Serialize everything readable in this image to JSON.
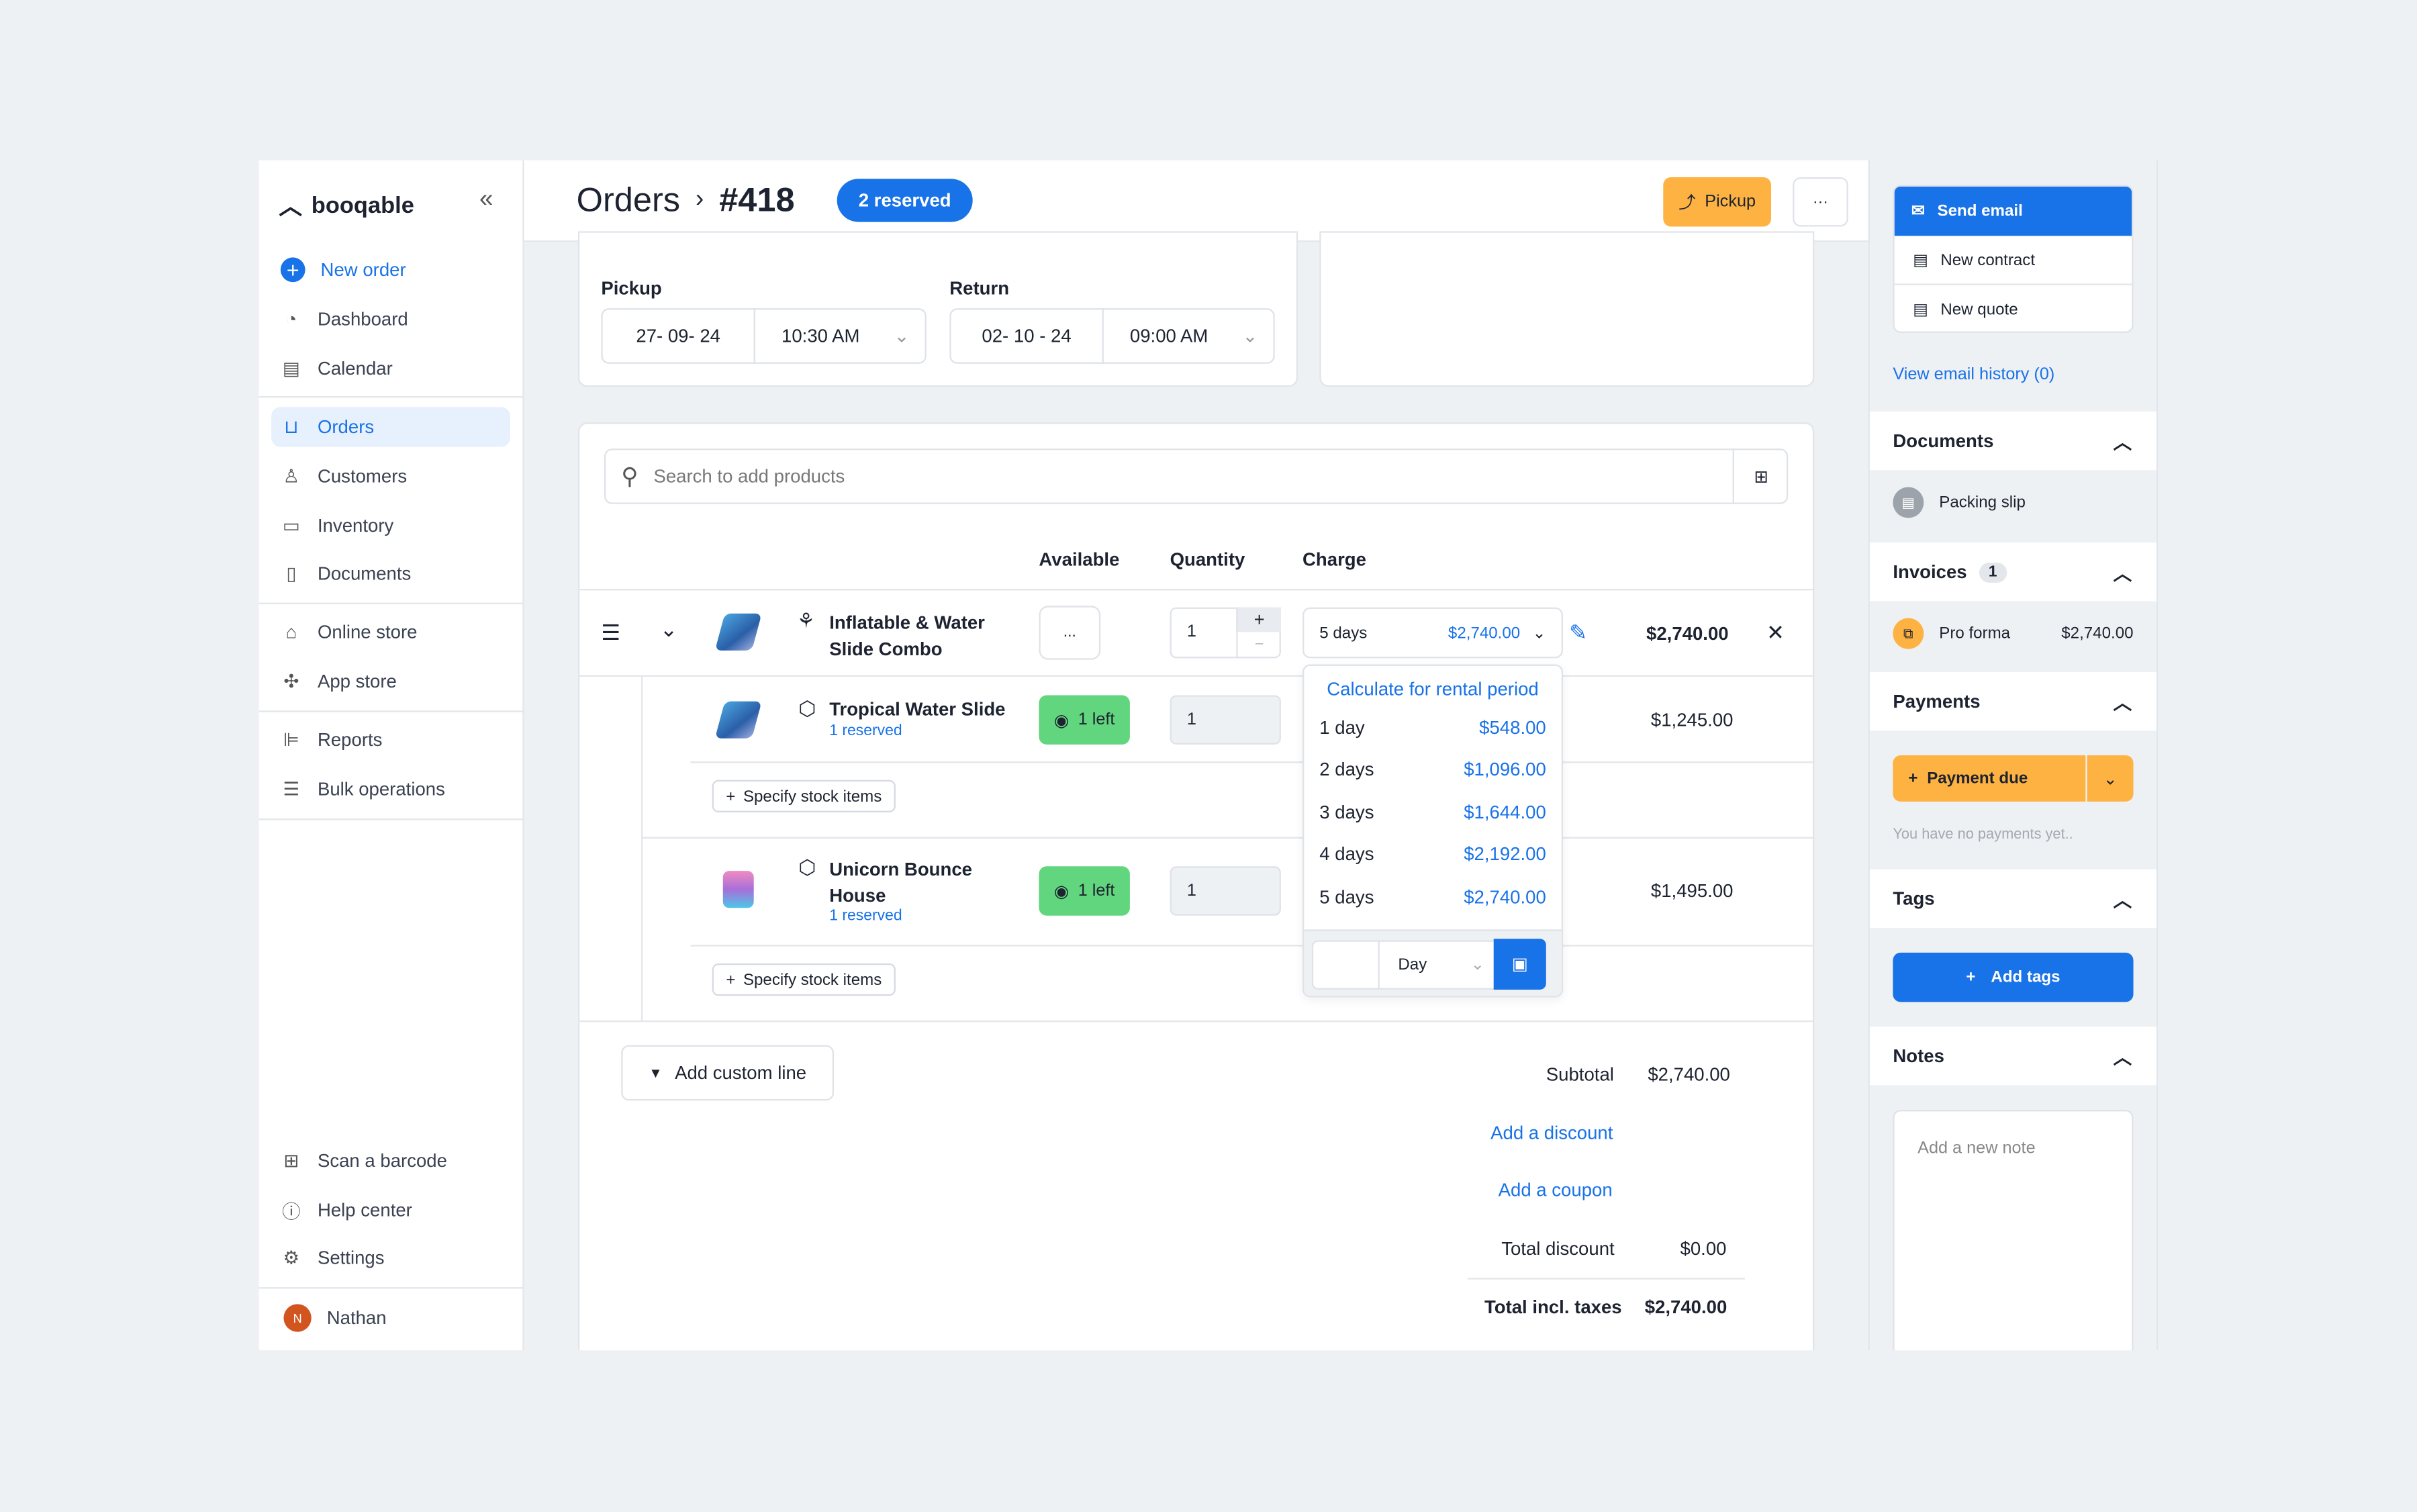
{
  "brand": "booqable",
  "sidebar": {
    "new_order": "New order",
    "items": [
      "Dashboard",
      "Calendar",
      "Orders",
      "Customers",
      "Inventory",
      "Documents",
      "Online store",
      "App store",
      "Reports",
      "Bulk operations"
    ],
    "bottom": [
      "Scan a barcode",
      "Help center",
      "Settings"
    ],
    "user": {
      "name": "Nathan",
      "initial": "N"
    }
  },
  "header": {
    "breadcrumb": "Orders",
    "order_number": "#418",
    "status_badge": "2 reserved",
    "pickup_button": "Pickup",
    "more_button": "···"
  },
  "dates": {
    "pickup_label": "Pickup",
    "pickup_date": "27- 09- 24",
    "pickup_time": "10:30 AM",
    "return_label": "Return",
    "return_date": "02- 10 - 24",
    "return_time": "09:00 AM"
  },
  "products": {
    "search_placeholder": "Search to add products",
    "columns": [
      "Available",
      "Quantity",
      "Charge"
    ],
    "bundle": {
      "name_line1": "Inflatable & Water",
      "name_line2": "Slide Combo",
      "available": "...",
      "quantity": "1",
      "charge_period": "5 days",
      "charge_price": "$2,740.00",
      "total": "$2,740.00"
    },
    "items": [
      {
        "name_line1": "Tropical Water Slide",
        "name_line2": "",
        "reserved": "1 reserved",
        "available": "1 left",
        "quantity": "1",
        "total": "$1,245.00",
        "specify": "Specify stock items"
      },
      {
        "name_line1": "Unicorn Bounce",
        "name_line2": "House",
        "reserved": "1 reserved",
        "available": "1 left",
        "quantity": "1",
        "total": "$1,495.00",
        "specify": "Specify stock items"
      }
    ]
  },
  "charge_dropdown": {
    "calculate": "Calculate for rental period",
    "options": [
      {
        "period": "1 day",
        "price": "$548.00"
      },
      {
        "period": "2 days",
        "price": "$1,096.00"
      },
      {
        "period": "3 days",
        "price": "$1,644.00"
      },
      {
        "period": "4 days",
        "price": "$2,192.00"
      },
      {
        "period": "5 days",
        "price": "$2,740.00"
      }
    ],
    "unit": "Day"
  },
  "totals": {
    "add_custom_line": "Add custom line",
    "subtotal_label": "Subtotal",
    "subtotal": "$2,740.00",
    "add_discount": "Add a discount",
    "add_coupon": "Add a coupon",
    "total_discount_label": "Total discount",
    "total_discount": "$0.00",
    "total_label": "Total incl. taxes",
    "total": "$2,740.00"
  },
  "right": {
    "send_email": "Send email",
    "new_contract": "New contract",
    "new_quote": "New quote",
    "email_history": "View email history (0)",
    "documents": "Documents",
    "packing_slip": "Packing slip",
    "invoices": "Invoices",
    "invoice_count": "1",
    "pro_forma": "Pro forma",
    "pro_forma_amount": "$2,740.00",
    "payments": "Payments",
    "payment_due": "Payment due",
    "no_payments": "You have no payments yet..",
    "tags": "Tags",
    "add_tags": "Add tags",
    "notes": "Notes",
    "note_placeholder": "Add a new note"
  },
  "colors": {
    "primary": "#1872e8",
    "warning": "#fdb242",
    "success": "#62d67e"
  }
}
